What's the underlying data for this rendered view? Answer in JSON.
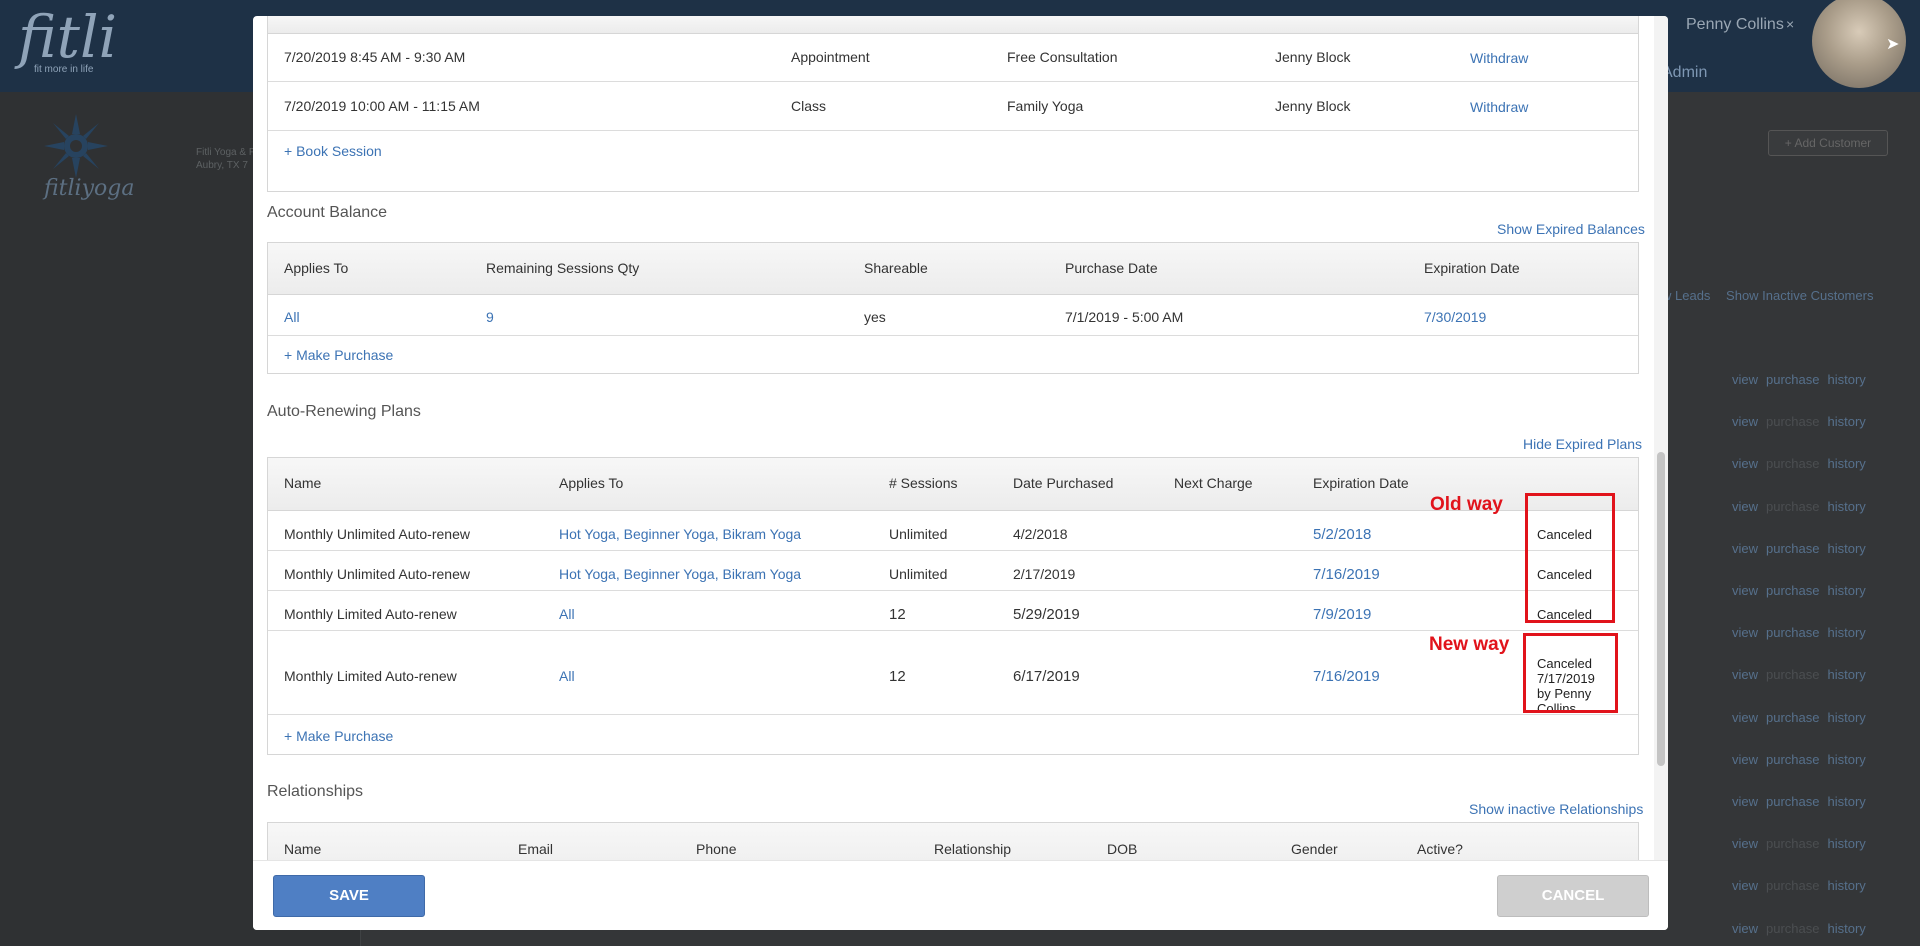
{
  "app": {
    "logo_text": "fitli",
    "logo_tagline": "fit more in life",
    "user_name": "Penny Collins",
    "user_close": "×",
    "admin_link": "Admin",
    "studio_name": "fitliyoga",
    "studio_address_line1": "Fitli Yoga & F",
    "studio_address_line2": "Aubry, TX 7",
    "add_customer": "+ Add Customer",
    "filter_leads": "w Leads",
    "filter_inactive": "Show Inactive Customers",
    "row_actions": {
      "view": "view",
      "purchase": "purchase",
      "history": "history"
    },
    "row_purchase_dim": [
      false,
      true,
      true,
      true,
      false,
      false,
      false,
      true,
      false,
      false,
      false,
      true,
      true,
      true
    ]
  },
  "sessions": {
    "rows": [
      {
        "time": "7/20/2019 8:45 AM - 9:30 AM",
        "type": "Appointment",
        "name": "Free Consultation",
        "staff": "Jenny Block",
        "action": "Withdraw"
      },
      {
        "time": "7/20/2019 10:00 AM - 11:15 AM",
        "type": "Class",
        "name": "Family Yoga",
        "staff": "Jenny Block",
        "action": "Withdraw"
      }
    ],
    "book_link": "+ Book Session"
  },
  "account_balance": {
    "title": "Account Balance",
    "show_expired": "Show Expired Balances",
    "headers": [
      "Applies To",
      "Remaining Sessions Qty",
      "Shareable",
      "Purchase Date",
      "Expiration Date"
    ],
    "row": {
      "applies_to": "All",
      "remaining": "9",
      "shareable": "yes",
      "purchase_date": "7/1/2019 - 5:00 AM",
      "expiration": "7/30/2019"
    },
    "make_purchase": "+ Make Purchase"
  },
  "plans": {
    "title": "Auto-Renewing Plans",
    "hide_expired": "Hide Expired Plans",
    "headers": [
      "Name",
      "Applies To",
      "# Sessions",
      "Date Purchased",
      "Next Charge",
      "Expiration Date"
    ],
    "rows": [
      {
        "name": "Monthly Unlimited Auto-renew",
        "applies_to": "Hot Yoga, Beginner Yoga, Bikram Yoga",
        "sessions": "Unlimited",
        "purchased": "4/2/2018",
        "next_charge": "",
        "expiration": "5/2/2018",
        "status": "Canceled"
      },
      {
        "name": "Monthly Unlimited Auto-renew",
        "applies_to": "Hot Yoga, Beginner Yoga, Bikram Yoga",
        "sessions": "Unlimited",
        "purchased": "2/17/2019",
        "next_charge": "",
        "expiration": "7/16/2019",
        "status": "Canceled"
      },
      {
        "name": "Monthly Limited Auto-renew",
        "applies_to": "All",
        "sessions": "12",
        "purchased": "5/29/2019",
        "next_charge": "",
        "expiration": "7/9/2019",
        "status": "Canceled"
      },
      {
        "name": "Monthly Limited Auto-renew",
        "applies_to": "All",
        "sessions": "12",
        "purchased": "6/17/2019",
        "next_charge": "",
        "expiration": "7/16/2019",
        "status_lines": [
          "Canceled",
          "7/17/2019",
          "by Penny",
          "Collins"
        ]
      }
    ],
    "make_purchase": "+ Make Purchase",
    "annotation_old": "Old way",
    "annotation_new": "New way",
    "annotation_color": "#e1131b"
  },
  "relationships": {
    "title": "Relationships",
    "show_inactive": "Show inactive Relationships",
    "headers": [
      "Name",
      "Email",
      "Phone",
      "Relationship",
      "DOB",
      "Gender",
      "Active?"
    ]
  },
  "footer": {
    "save": "SAVE",
    "cancel": "CANCEL"
  },
  "colors": {
    "link": "#3c73b4",
    "save": "#4f7fc4",
    "cancel": "#cfcfcf",
    "topbar": "#1e3146"
  }
}
